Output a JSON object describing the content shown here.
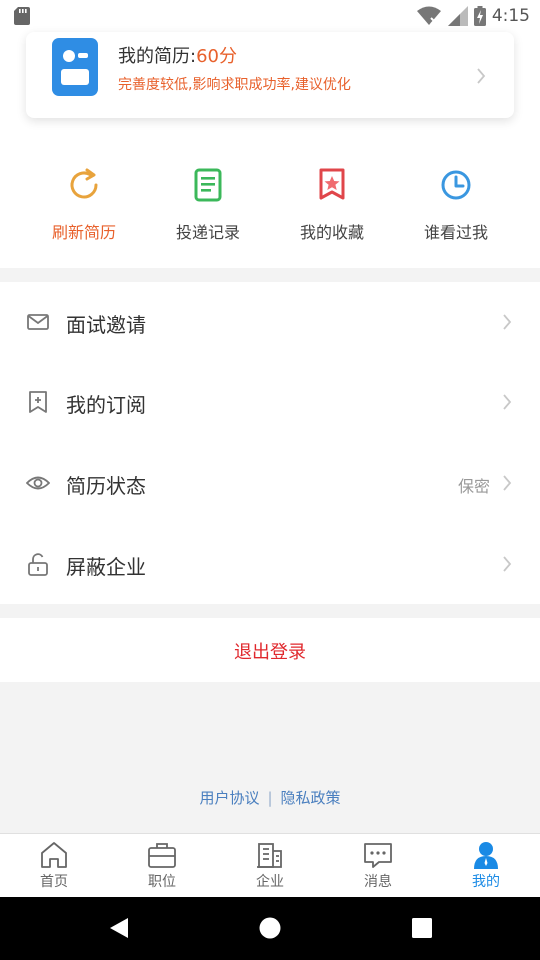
{
  "status_bar": {
    "time": "4:15",
    "icons": [
      "sd-card-icon",
      "wifi-icon",
      "signal-icon",
      "battery-charging-icon"
    ]
  },
  "resume_card": {
    "title": "我的简历:",
    "score": "60分",
    "hint": "完善度较低,影响求职成功率,建议优化",
    "icon": "resume-icon"
  },
  "quick_actions": [
    {
      "label": "刷新简历",
      "icon": "refresh-icon",
      "color": "#e8a33c",
      "active": true
    },
    {
      "label": "投递记录",
      "icon": "document-icon",
      "color": "#3bb85a",
      "active": false
    },
    {
      "label": "我的收藏",
      "icon": "bookmark-star-icon",
      "color": "#e0464a",
      "active": false
    },
    {
      "label": "谁看过我",
      "icon": "clock-icon",
      "color": "#3a97e0",
      "active": false
    }
  ],
  "menu": [
    {
      "label": "面试邀请",
      "icon": "mail-icon",
      "value": ""
    },
    {
      "label": "我的订阅",
      "icon": "bookmark-plus-icon",
      "value": ""
    },
    {
      "label": "简历状态",
      "icon": "eye-icon",
      "value": "保密"
    },
    {
      "label": "屏蔽企业",
      "icon": "lock-icon",
      "value": ""
    }
  ],
  "logout": {
    "label": "退出登录",
    "color": "#e0282d"
  },
  "footer": {
    "user_agreement": "用户协议",
    "separator": "|",
    "privacy_policy": "隐私政策"
  },
  "tabbar": [
    {
      "label": "首页",
      "icon": "home-icon",
      "active": false
    },
    {
      "label": "职位",
      "icon": "briefcase-icon",
      "active": false
    },
    {
      "label": "企业",
      "icon": "building-icon",
      "active": false
    },
    {
      "label": "消息",
      "icon": "message-icon",
      "active": false
    },
    {
      "label": "我的",
      "icon": "user-icon",
      "active": true
    }
  ],
  "colors": {
    "accent": "#1a8ae5",
    "warning": "#e8612c"
  }
}
